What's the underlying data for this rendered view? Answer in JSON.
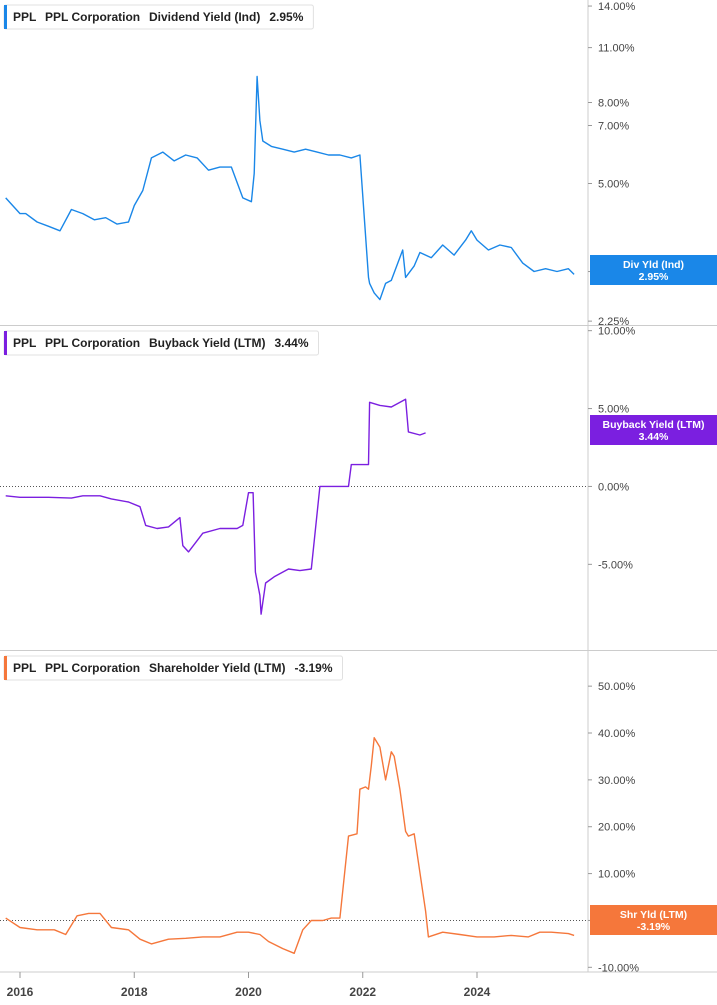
{
  "chart_data": [
    {
      "type": "line",
      "ticker": "PPL",
      "company": "PPL Corporation",
      "metric": "Dividend Yield (Ind)",
      "current_value": "2.95%",
      "tag_label": "Div Yld (Ind)",
      "tag_value": "2.95%",
      "color": "#1a87e8",
      "scale": "log",
      "ylim": [
        2.2,
        14.5
      ],
      "y_ticks": [
        {
          "value": 14,
          "label": "14.00%"
        },
        {
          "value": 11,
          "label": "11.00%"
        },
        {
          "value": 8,
          "label": "8.00%"
        },
        {
          "value": 7,
          "label": "7.00%"
        },
        {
          "value": 5,
          "label": "5.00%"
        },
        {
          "value": 3,
          "label": "3.00%"
        },
        {
          "value": 2.25,
          "label": "2.25%"
        }
      ],
      "zero_line": false,
      "series": [
        {
          "x": [
            2015.75,
            2016.0,
            2016.1,
            2016.3,
            2016.5,
            2016.7,
            2016.9,
            2017.1,
            2017.3,
            2017.5,
            2017.7,
            2017.9,
            2018.0,
            2018.15,
            2018.3,
            2018.5,
            2018.7,
            2018.9,
            2019.1,
            2019.3,
            2019.5,
            2019.7,
            2019.9,
            2020.05,
            2020.1,
            2020.15,
            2020.2,
            2020.25,
            2020.4,
            2020.6,
            2020.8,
            2021.0,
            2021.2,
            2021.4,
            2021.6,
            2021.8,
            2021.95,
            2022.1,
            2022.12,
            2022.2,
            2022.3,
            2022.4,
            2022.5,
            2022.7,
            2022.75,
            2022.9,
            2023.0,
            2023.2,
            2023.4,
            2023.6,
            2023.8,
            2023.9,
            2024.0,
            2024.2,
            2024.4,
            2024.6,
            2024.8,
            2025.0,
            2025.2,
            2025.4,
            2025.6,
            2025.7
          ],
          "y": [
            4.6,
            4.2,
            4.2,
            4.0,
            3.9,
            3.8,
            4.3,
            4.2,
            4.05,
            4.1,
            3.95,
            4.0,
            4.4,
            4.8,
            5.8,
            6.0,
            5.7,
            5.9,
            5.8,
            5.4,
            5.5,
            5.5,
            4.6,
            4.5,
            5.3,
            9.3,
            7.2,
            6.4,
            6.2,
            6.1,
            6.0,
            6.1,
            6.0,
            5.9,
            5.9,
            5.8,
            5.9,
            2.9,
            2.8,
            2.65,
            2.55,
            2.8,
            2.85,
            3.4,
            2.9,
            3.1,
            3.35,
            3.25,
            3.5,
            3.3,
            3.6,
            3.8,
            3.6,
            3.4,
            3.5,
            3.45,
            3.15,
            3.0,
            3.05,
            3.0,
            3.05,
            2.95
          ]
        }
      ]
    },
    {
      "type": "line",
      "ticker": "PPL",
      "company": "PPL Corporation",
      "metric": "Buyback Yield (LTM)",
      "current_value": "3.44%",
      "tag_label": "Buyback Yield (LTM)",
      "tag_value": "3.44%",
      "color": "#7b1fe0",
      "scale": "linear",
      "ylim": [
        -10.5,
        10.3
      ],
      "y_ticks": [
        {
          "value": 10,
          "label": "10.00%"
        },
        {
          "value": 5,
          "label": "5.00%"
        },
        {
          "value": 0,
          "label": "0.00%"
        },
        {
          "value": -5,
          "label": "-5.00%"
        }
      ],
      "zero_line": true,
      "series": [
        {
          "x": [
            2015.75,
            2016.0,
            2016.5,
            2016.9,
            2017.1,
            2017.4,
            2017.6,
            2017.9,
            2018.1,
            2018.2,
            2018.4,
            2018.6,
            2018.8,
            2018.85,
            2018.95,
            2019.2,
            2019.5,
            2019.8,
            2019.9,
            2020.0,
            2020.08,
            2020.12,
            2020.2,
            2020.22,
            2020.3,
            2020.45,
            2020.7,
            2020.9,
            2021.1,
            2021.25,
            2021.5,
            2021.75,
            2021.8,
            2021.9,
            2022.1,
            2022.12,
            2022.3,
            2022.5,
            2022.75,
            2022.8,
            2023.0,
            2023.1
          ],
          "y": [
            -0.6,
            -0.7,
            -0.7,
            -0.75,
            -0.6,
            -0.6,
            -0.8,
            -1.0,
            -1.3,
            -2.5,
            -2.7,
            -2.6,
            -2.0,
            -3.8,
            -4.2,
            -3.0,
            -2.7,
            -2.7,
            -2.5,
            -0.4,
            -0.4,
            -5.5,
            -7.0,
            -8.2,
            -6.2,
            -5.8,
            -5.3,
            -5.4,
            -5.3,
            0.0,
            0.0,
            0.0,
            1.4,
            1.4,
            1.4,
            5.4,
            5.2,
            5.1,
            5.6,
            3.5,
            3.3,
            3.44
          ]
        }
      ]
    },
    {
      "type": "line",
      "ticker": "PPL",
      "company": "PPL Corporation",
      "metric": "Shareholder Yield (LTM)",
      "current_value": "-3.19%",
      "tag_label": "Shr Yld (LTM)",
      "tag_value": "-3.19%",
      "color": "#f5773b",
      "scale": "linear",
      "ylim": [
        -11,
        57.5
      ],
      "y_ticks": [
        {
          "value": 50,
          "label": "50.00%"
        },
        {
          "value": 40,
          "label": "40.00%"
        },
        {
          "value": 30,
          "label": "30.00%"
        },
        {
          "value": 20,
          "label": "20.00%"
        },
        {
          "value": 10,
          "label": "10.00%"
        },
        {
          "value": 0,
          "label": "0.00%"
        },
        {
          "value": -10,
          "label": "-10.00%"
        }
      ],
      "zero_line": true,
      "series": [
        {
          "x": [
            2015.75,
            2016.0,
            2016.3,
            2016.6,
            2016.8,
            2017.0,
            2017.2,
            2017.4,
            2017.6,
            2017.9,
            2018.1,
            2018.3,
            2018.6,
            2018.9,
            2019.2,
            2019.5,
            2019.8,
            2020.0,
            2020.2,
            2020.35,
            2020.6,
            2020.8,
            2020.95,
            2021.1,
            2021.3,
            2021.45,
            2021.6,
            2021.75,
            2021.9,
            2021.95,
            2022.05,
            2022.1,
            2022.15,
            2022.2,
            2022.3,
            2022.4,
            2022.5,
            2022.55,
            2022.65,
            2022.75,
            2022.8,
            2022.9,
            2023.1,
            2023.15,
            2023.4,
            2023.7,
            2024.0,
            2024.3,
            2024.6,
            2024.9,
            2025.1,
            2025.3,
            2025.6,
            2025.7
          ],
          "y": [
            0.5,
            -1.5,
            -2.0,
            -2.0,
            -3.0,
            1.0,
            1.5,
            1.5,
            -1.5,
            -2.0,
            -4.0,
            -5.0,
            -4.0,
            -3.8,
            -3.5,
            -3.5,
            -2.5,
            -2.5,
            -3.0,
            -4.5,
            -6.0,
            -7.0,
            -2.0,
            0.0,
            0.0,
            0.5,
            0.5,
            18.0,
            18.5,
            28.0,
            28.5,
            28.0,
            33.0,
            39.0,
            37.0,
            30.0,
            36.0,
            35.0,
            28.0,
            19.0,
            18.0,
            18.5,
            2.0,
            -3.5,
            -2.5,
            -3.0,
            -3.5,
            -3.5,
            -3.2,
            -3.5,
            -2.5,
            -2.5,
            -2.8,
            -3.19
          ]
        }
      ]
    }
  ],
  "x_axis": {
    "ticks": [
      {
        "value": 2016,
        "label": "2016"
      },
      {
        "value": 2018,
        "label": "2018"
      },
      {
        "value": 2020,
        "label": "2020"
      },
      {
        "value": 2022,
        "label": "2022"
      },
      {
        "value": 2024,
        "label": "2024"
      }
    ]
  }
}
